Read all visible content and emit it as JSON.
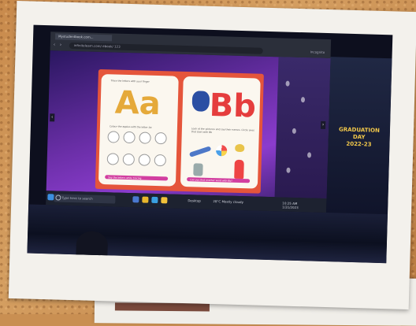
{
  "browser": {
    "tab_title": "Mystudentbook.com...",
    "url": "infinitelearn.com/ ebook/ 123",
    "profile_label": "Incognito"
  },
  "book": {
    "left_page": {
      "instruction_top": "Trace the letters with your finger",
      "letters": "Aa",
      "instruction_mid": "Colour the apples with the letter Aa",
      "footer_pill": "Say the letters while tracing"
    },
    "right_page": {
      "letters": "Bb",
      "instruction_mid": "Look at the pictures and say their names. Circle ones that start with Bb",
      "footer_pill": "Can you find another word with Bb?"
    }
  },
  "taskbar": {
    "search_placeholder": "Type here to search",
    "weather": "28°C Mostly cloudy",
    "time": "10:25 AM",
    "date": "1/31/2023",
    "center_label": "Desktop"
  },
  "poster": {
    "title_line1": "GRADUATION",
    "title_line2": "DAY",
    "title_line3": "2022-23"
  },
  "colors": {
    "book_border": "#e5553b",
    "letter_a": "#e5a93a",
    "letter_b": "#e53d3d",
    "webpage_bg": "#6b2fa8"
  }
}
